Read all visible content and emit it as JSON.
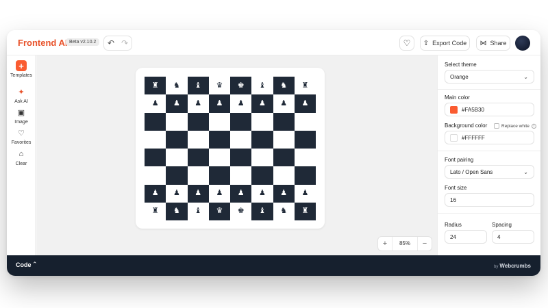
{
  "header": {
    "brand": "Frontend AI",
    "brand_icon": "sparkle-icon",
    "version": "Beta v2.10.2",
    "export_label": "Export Code",
    "share_label": "Share"
  },
  "sidebar": {
    "items": [
      {
        "label": "Templates",
        "icon": "plus-icon"
      },
      {
        "label": "Ask AI",
        "icon": "sparkle-icon"
      },
      {
        "label": "Image",
        "icon": "image-icon"
      },
      {
        "label": "Favorites",
        "icon": "heart-icon"
      },
      {
        "label": "Clear",
        "icon": "trash-icon"
      }
    ]
  },
  "canvas": {
    "zoom": "85%",
    "board": {
      "dark_color": "#1F2937",
      "light_color": "#FFFFFF",
      "rows": [
        [
          "♜",
          "♞",
          "♝",
          "♛",
          "♚",
          "♝",
          "♞",
          "♜"
        ],
        [
          "♟",
          "♟",
          "♟",
          "♟",
          "♟",
          "♟",
          "♟",
          "♟"
        ],
        [
          "",
          "",
          "",
          "",
          "",
          "",
          "",
          ""
        ],
        [
          "",
          "",
          "",
          "",
          "",
          "",
          "",
          ""
        ],
        [
          "",
          "",
          "",
          "",
          "",
          "",
          "",
          ""
        ],
        [
          "",
          "",
          "",
          "",
          "",
          "",
          "",
          ""
        ],
        [
          "♟",
          "♟",
          "♟",
          "♟",
          "♟",
          "♟",
          "♟",
          "♟"
        ],
        [
          "♜",
          "♞",
          "♝",
          "♛",
          "♚",
          "♝",
          "♞",
          "♜"
        ]
      ]
    }
  },
  "panel": {
    "theme_label": "Select theme",
    "theme_value": "Orange",
    "main_color_label": "Main color",
    "main_color_value": "#FA5B30",
    "bg_color_label": "Background color",
    "replace_white_label": "Replace white",
    "bg_color_value": "#FFFFFF",
    "font_pairing_label": "Font pairing",
    "font_pairing_value": "Lato / Open Sans",
    "font_size_label": "Font size",
    "font_size_value": "16",
    "radius_label": "Radius",
    "radius_value": "24",
    "spacing_label": "Spacing",
    "spacing_value": "4"
  },
  "codebar": {
    "title": "Code",
    "by": "by",
    "brand": "Webcrumbs"
  }
}
